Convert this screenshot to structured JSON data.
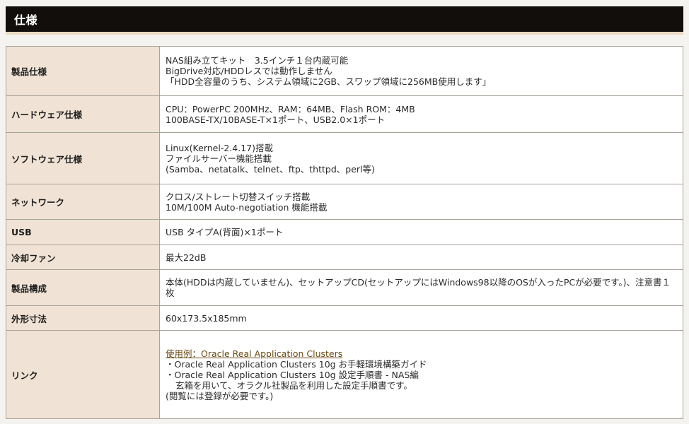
{
  "section": {
    "title": "仕様"
  },
  "specs": {
    "product": {
      "label": "製品仕様",
      "lines": [
        "NAS組み立てキット　3.5インチ１台内蔵可能",
        "BigDrive対応/HDDレスでは動作しません",
        "「HDD全容量のうち、システム領域に2GB、スワップ領域に256MB使用します」"
      ]
    },
    "hardware": {
      "label": "ハードウェア仕様",
      "lines": [
        "CPU：PowerPC 200MHz、RAM：64MB、Flash ROM：4MB",
        "100BASE-TX/10BASE-T×1ポート、USB2.0×1ポート"
      ]
    },
    "software": {
      "label": "ソフトウェア仕様",
      "lines": [
        "Linux(Kernel-2.4.17)搭載",
        "ファイルサーバー機能搭載",
        "(Samba、netatalk、telnet、ftp、thttpd、perl等)"
      ]
    },
    "network": {
      "label": "ネットワーク",
      "lines": [
        "クロス/ストレート切替スイッチ搭載",
        "10M/100M Auto-negotiation 機能搭載"
      ]
    },
    "usb": {
      "label": "USB",
      "value": "USB タイプA(背面)×1ポート"
    },
    "cooling": {
      "label": "冷却ファン",
      "value": "最大22dB"
    },
    "package": {
      "label": "製品構成",
      "value": "本体(HDDは内蔵していません)、セットアップCD(セットアップにはWindows98以降のOSが入ったPCが必要です。)、注意書１枚"
    },
    "dimensions": {
      "label": "外形寸法",
      "value": "60x173.5x185mm"
    },
    "links": {
      "label": "リンク",
      "link_text": "使用例：Oracle Real Application Clusters",
      "lines": [
        "・Oracle Real Application Clusters 10g お手軽環境構築ガイド",
        "・Oracle Real Application Clusters 10g 設定手順書 - NAS編",
        "玄箱を用いて、オラクル社製品を利用した設定手順書です。",
        "(閲覧には登録が必要です。)"
      ]
    }
  }
}
